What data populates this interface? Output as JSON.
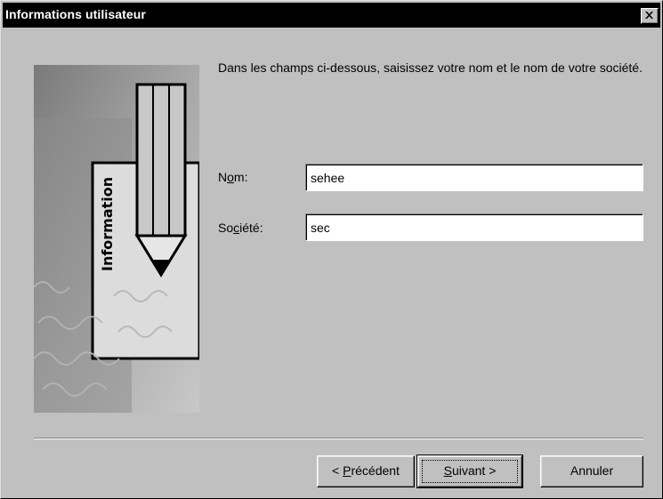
{
  "window": {
    "title": "Informations utilisateur",
    "close_glyph": "✕"
  },
  "side_image": {
    "caption": "Information",
    "icon": "pencil-on-document-icon"
  },
  "instruction": "Dans les champs ci-dessous, saisissez votre nom et le nom de votre société.",
  "fields": {
    "name": {
      "label_pre": "N",
      "label_acc": "o",
      "label_post": "m:",
      "value": "sehee"
    },
    "company": {
      "label_pre": "So",
      "label_acc": "c",
      "label_post": "iété:",
      "value": "sec"
    }
  },
  "buttons": {
    "back": {
      "pre": "< ",
      "acc": "P",
      "post": "récédent"
    },
    "next": {
      "pre": "",
      "acc": "S",
      "post": "uivant >"
    },
    "cancel": {
      "label": "Annuler"
    }
  }
}
